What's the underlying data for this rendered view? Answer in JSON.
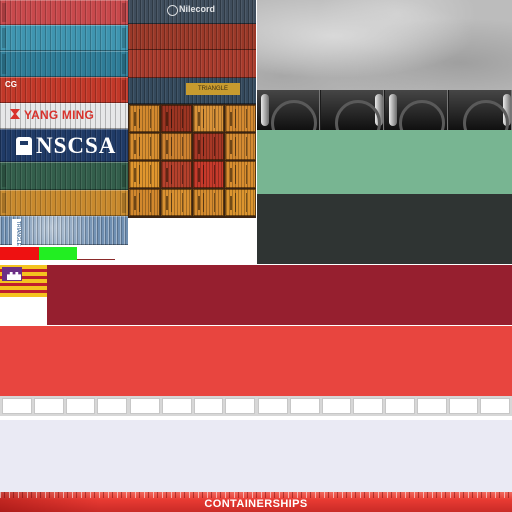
{
  "containers": {
    "yang_ming_label": "YANG MING",
    "nscsa_label": "NSCSA",
    "cma_label": "CG",
    "nile_label": "Nilecord",
    "triangle_label": "TRIANGLE",
    "stamp_label": "TRIANGLE"
  },
  "hull": {
    "name": "CONTAINERSHIPS"
  },
  "colors": {
    "concrete": "#bcbcbc",
    "green_band": "#78b592",
    "dark_band": "#2f3433",
    "crimson_band": "#961f2f",
    "red_band": "#e8453f",
    "lavender_band": "#eaeaf4",
    "swatch_red": "#ee1111",
    "swatch_green": "#22ee22"
  }
}
